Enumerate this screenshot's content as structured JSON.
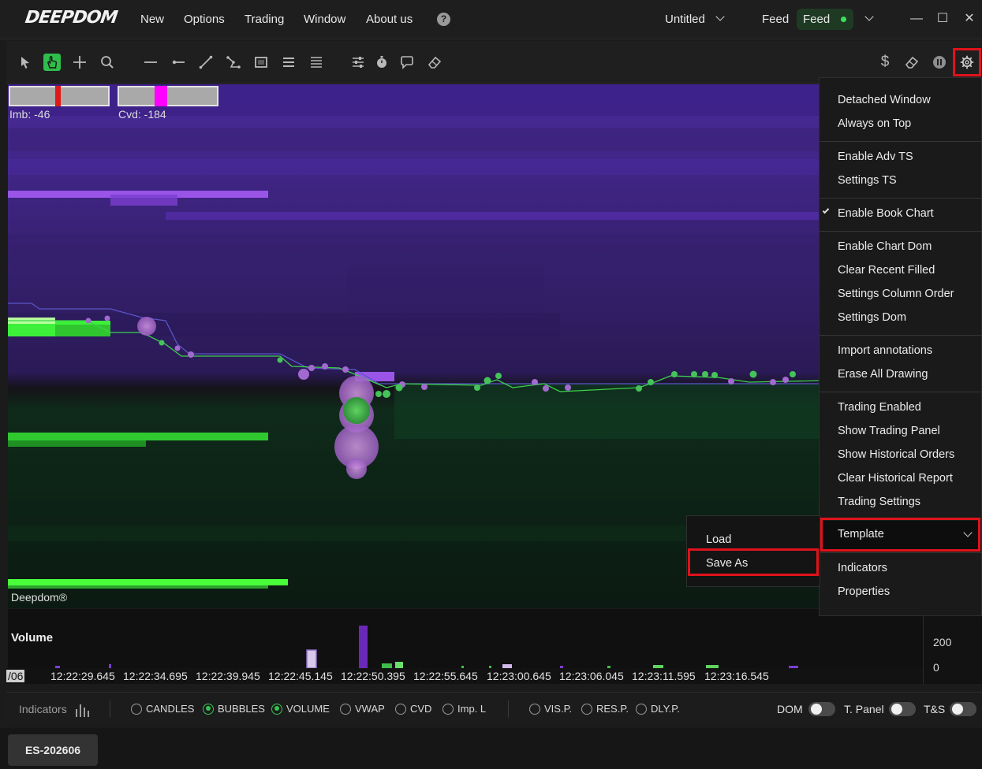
{
  "app": {
    "logo_text": "DEEPDOM",
    "menu": [
      "New",
      "Options",
      "Trading",
      "Window",
      "About us"
    ],
    "help_label": "?",
    "workspace_title": "Untitled",
    "feed_label": "Feed",
    "feed_status": "Feed",
    "window_controls": {
      "minimize": "—",
      "maximize": "☐",
      "close": "✕"
    }
  },
  "toolbar": {
    "tools": [
      "pointer-icon",
      "hand-icon",
      "crosshair-icon",
      "zoom-icon",
      "horizontal-line-icon",
      "ray-icon",
      "trend-line-icon",
      "polyline-icon",
      "rectangle-icon",
      "list-icon",
      "grid-lines-icon",
      "sliders-icon",
      "timer-icon",
      "comment-icon",
      "eraser-icon"
    ],
    "right_tools": [
      "dollar-icon",
      "eraser-icon",
      "pause-icon",
      "gear-icon"
    ],
    "dollar_label": "$"
  },
  "chart": {
    "imbalance_label": "Imb: -46",
    "cvd_label": "Cvd: -184",
    "brand": "Deepdom®",
    "colors": {
      "bid": "#39d63a",
      "ask": "#7a3cd0",
      "bubble": "#b36ad6",
      "meter_imb": "#e01818",
      "meter_cvd": "#ff00ff"
    }
  },
  "volume": {
    "title": "Volume",
    "scale": [
      "200",
      "0"
    ],
    "date_stub": "/06",
    "times": [
      "12:22:29.645",
      "12:22:34.695",
      "12:22:39.945",
      "12:22:45.145",
      "12:22:50.395",
      "12:22:55.645",
      "12:23:00.645",
      "12:23:06.045",
      "12:23:11.595",
      "12:23:16.545"
    ]
  },
  "indicators": {
    "label": "Indicators",
    "options": [
      {
        "label": "CANDLES",
        "on": false
      },
      {
        "label": "BUBBLES",
        "on": true
      },
      {
        "label": "VOLUME",
        "on": true
      },
      {
        "label": "VWAP",
        "on": false
      },
      {
        "label": "CVD",
        "on": false
      },
      {
        "label": "Imp. L",
        "on": false
      },
      {
        "label": "VIS.P.",
        "on": false
      },
      {
        "label": "RES.P.",
        "on": false
      },
      {
        "label": "DLY.P.",
        "on": false
      }
    ],
    "toggles": [
      {
        "label": "DOM",
        "on": false
      },
      {
        "label": "T. Panel",
        "on": false
      },
      {
        "label": "T&S",
        "on": false
      }
    ]
  },
  "footer": {
    "symbol": "ES-202606"
  },
  "settings_menu": {
    "groups": [
      [
        "Detached Window",
        "Always on Top"
      ],
      [
        "Enable Adv TS",
        "Settings TS"
      ],
      [
        "Enable Book Chart"
      ],
      [
        "Enable Chart Dom",
        "Clear Recent Filled",
        "Settings Column Order",
        "Settings Dom"
      ],
      [
        "Import annotations",
        "Erase All Drawing"
      ],
      [
        "Trading Enabled",
        "Show Trading Panel",
        "Show Historical Orders",
        "Clear Historical Report",
        "Trading Settings"
      ],
      [
        "Template"
      ],
      [
        "Indicators",
        "Properties"
      ]
    ],
    "checked": "Enable Book Chart"
  },
  "template_submenu": [
    "Load",
    "Save As"
  ]
}
